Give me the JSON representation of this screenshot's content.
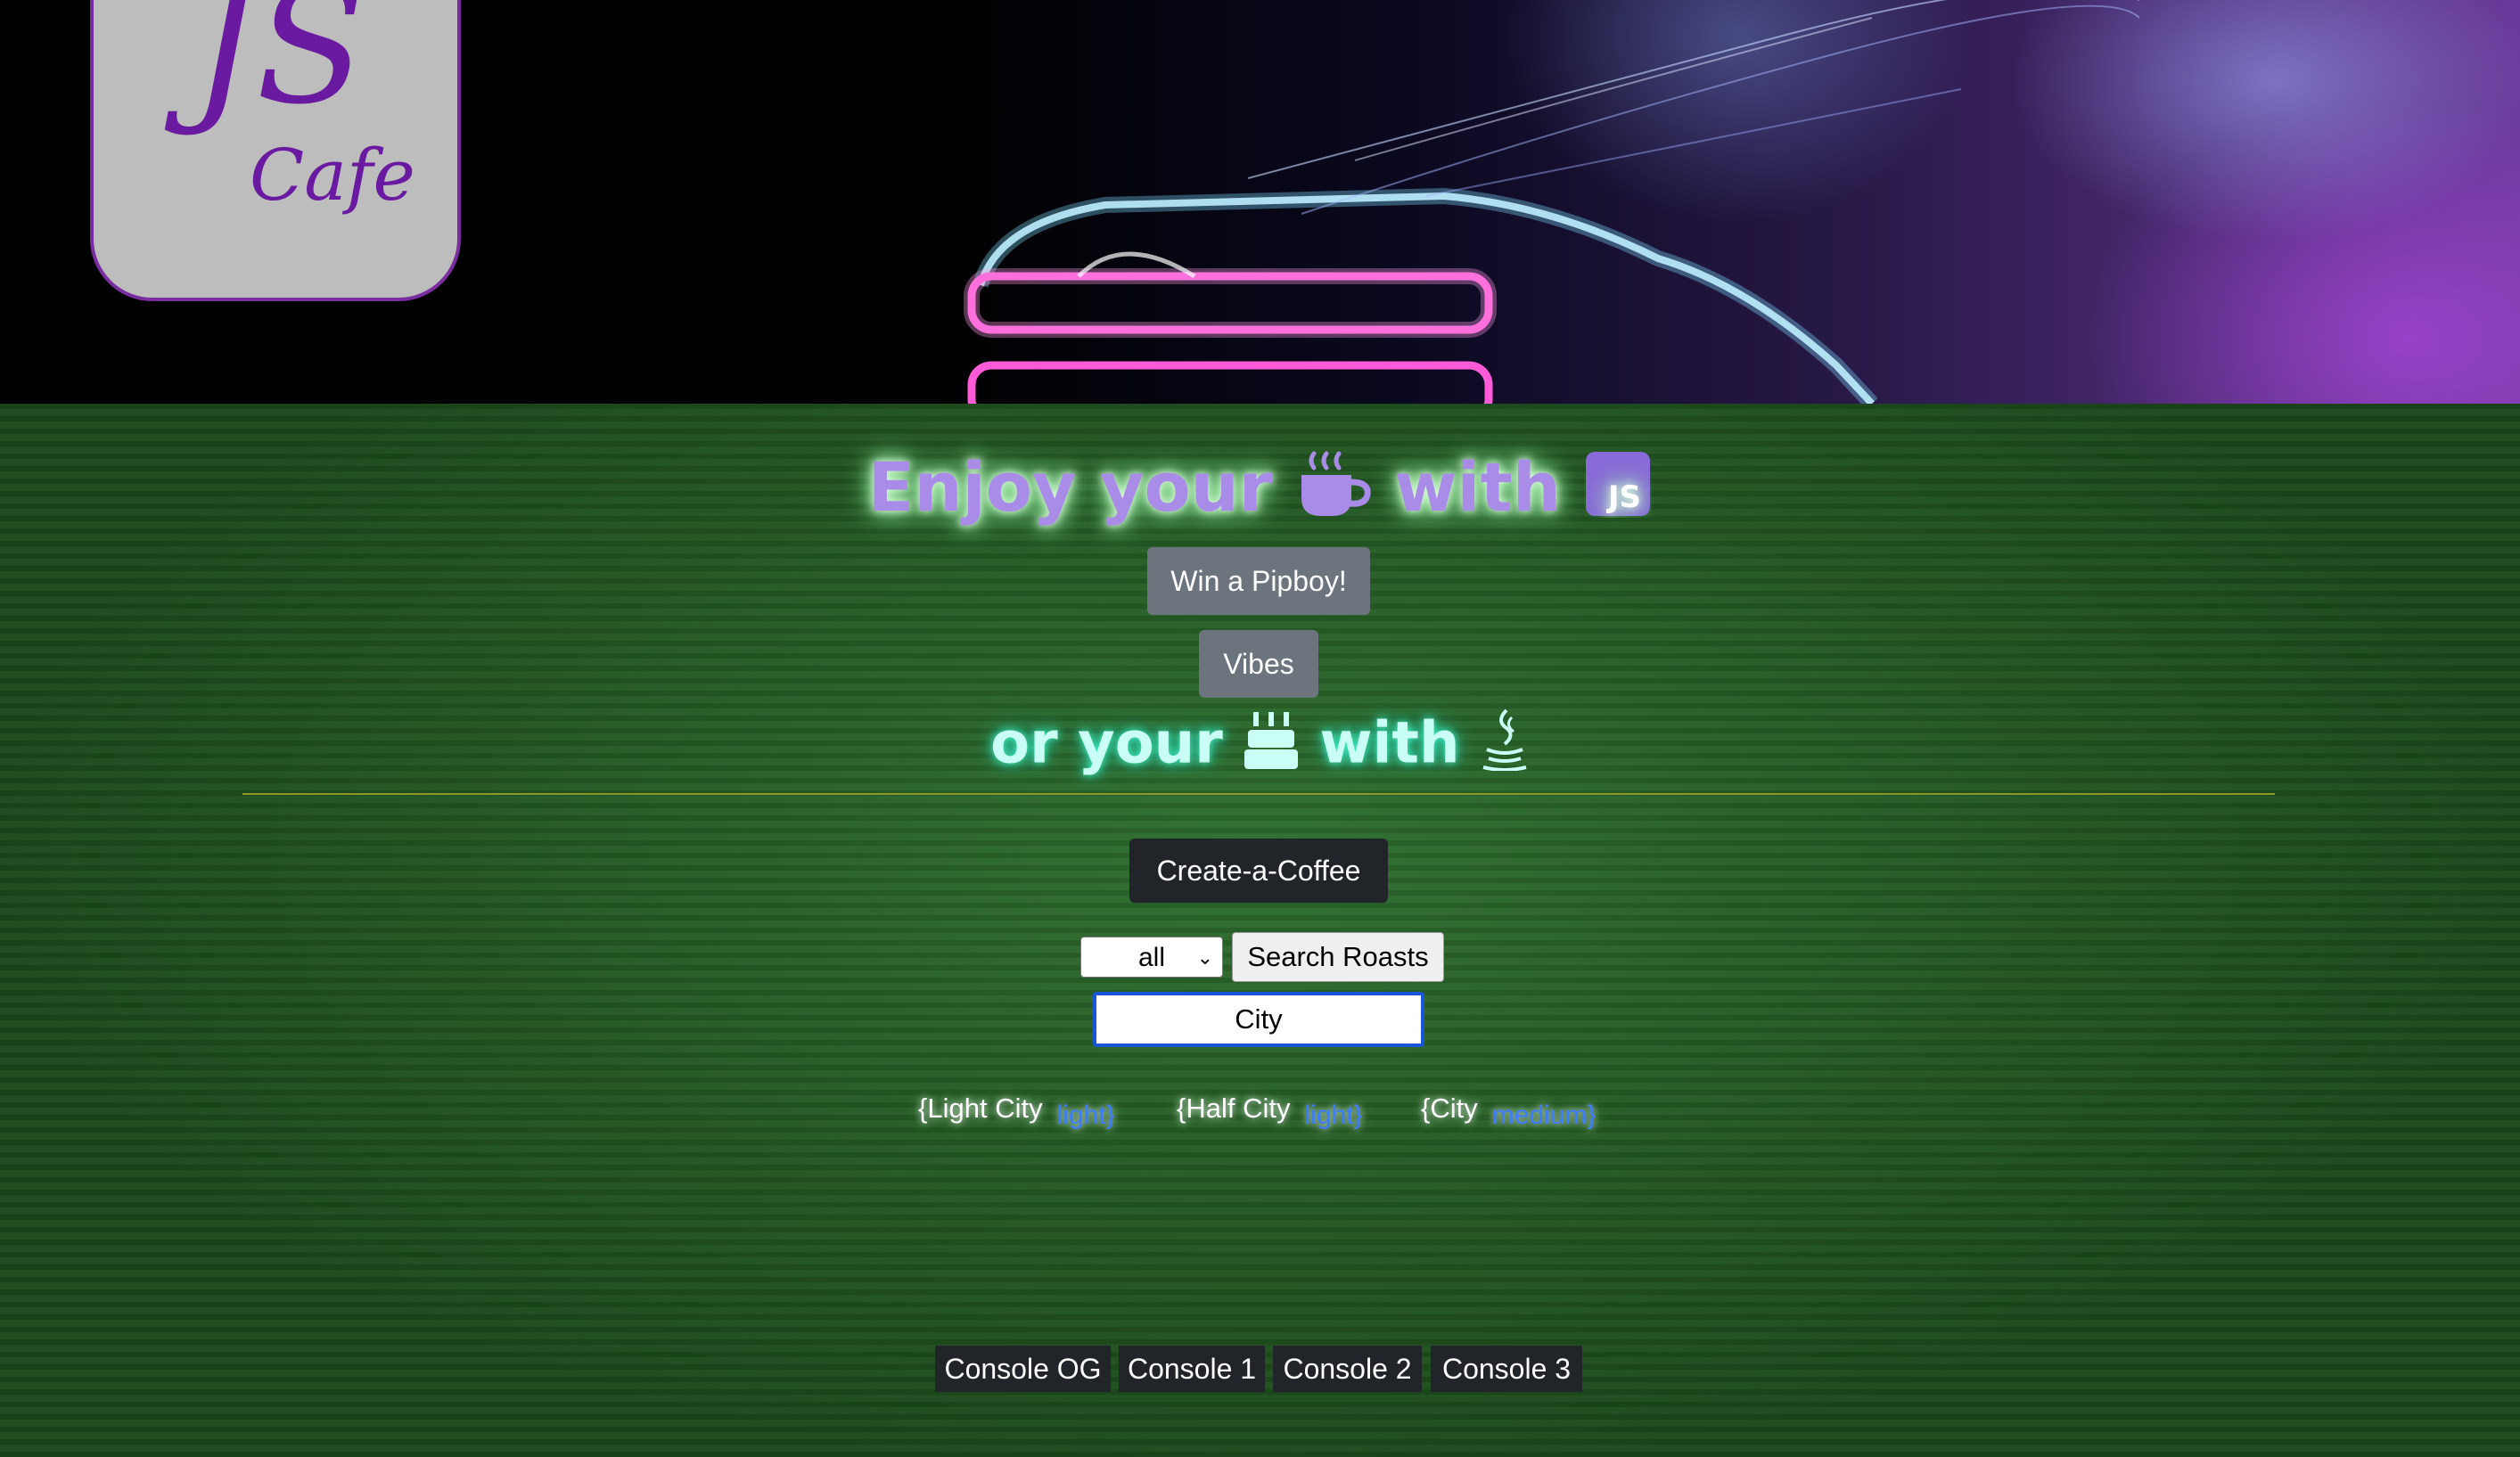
{
  "header": {
    "logo_js": "JS",
    "logo_cafe": "Cafe"
  },
  "headline1": {
    "pre": "Enjoy your",
    "mid": "with",
    "badge": "JS"
  },
  "buttons": {
    "pipboy": "Win a Pipboy!",
    "vibes": "Vibes",
    "create": "Create-a-Coffee",
    "search": "Search Roasts"
  },
  "headline2": {
    "pre": "or your",
    "mid": "with"
  },
  "search": {
    "roast_selected": "all",
    "city_value": "City"
  },
  "coffees": [
    {
      "name": "{Light City",
      "roast": "light}"
    },
    {
      "name": "{Half City",
      "roast": "light}"
    },
    {
      "name": "{City",
      "roast": "medium}"
    }
  ],
  "consoles": [
    "Console OG",
    "Console 1",
    "Console 2",
    "Console 3"
  ],
  "colors": {
    "brand_purple": "#7a2da0",
    "headline_purple": "#a98be8",
    "headline_cyan": "#c9fff5",
    "page_green": "#255a25",
    "roast_blue": "#3d7cff",
    "focus_blue": "#1a55d8"
  }
}
